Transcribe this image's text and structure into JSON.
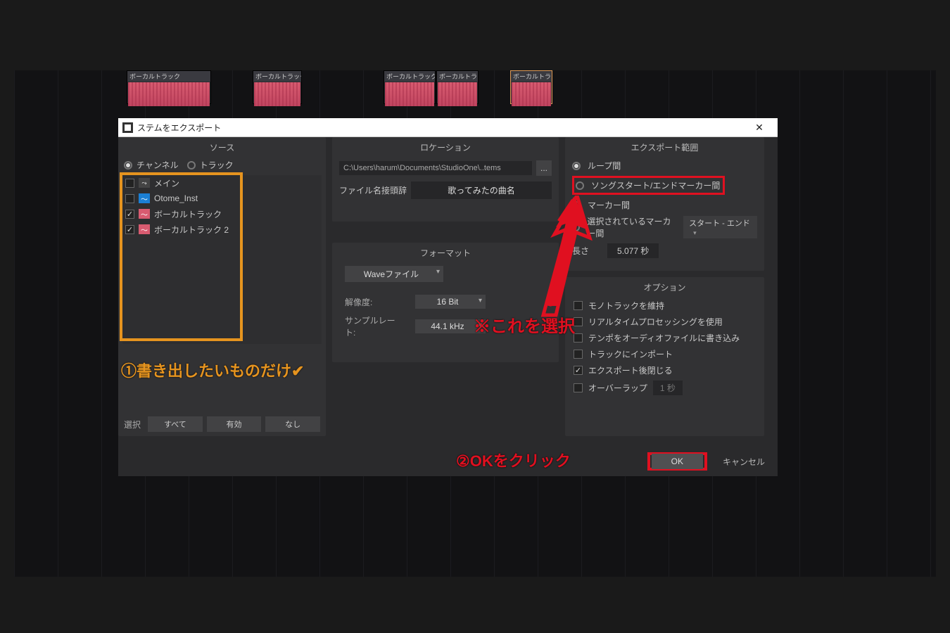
{
  "dialog": {
    "title": "ステムをエクスポート"
  },
  "source": {
    "header": "ソース",
    "radio_channel": "チャンネル",
    "radio_track": "トラック",
    "tracks": [
      {
        "checked": false,
        "icon": "out",
        "label": "メイン"
      },
      {
        "checked": false,
        "icon": "blue",
        "label": "Otome_Inst"
      },
      {
        "checked": true,
        "icon": "pink",
        "label": "ボーカルトラック"
      },
      {
        "checked": true,
        "icon": "pink",
        "label": "ボーカルトラック 2"
      }
    ],
    "select_label": "選択",
    "btn_all": "すべて",
    "btn_enabled": "有効",
    "btn_none": "なし"
  },
  "location": {
    "header": "ロケーション",
    "path": "C:\\Users\\harum\\Documents\\StudioOne\\..tems",
    "prefix_label": "ファイル名接頭辞",
    "prefix_value": "歌ってみたの曲名"
  },
  "format": {
    "header": "フォーマット",
    "filetype": "Waveファイル",
    "res_label": "解像度:",
    "res_value": "16 Bit",
    "rate_label": "サンプルレート:",
    "rate_value": "44.1 kHz"
  },
  "range": {
    "header": "エクスポート範囲",
    "opt_loop": "ループ間",
    "opt_songmarker": "ソングスタート/エンドマーカー間",
    "opt_marker": "マーカー間",
    "opt_selmarker": "選択されているマーカー間",
    "selmarker_value": "スタート - エンド",
    "length_label": "長さ",
    "length_value": "5.077 秒"
  },
  "options": {
    "header": "オプション",
    "opt_mono": "モノトラックを維持",
    "opt_realtime": "リアルタイムプロセッシングを使用",
    "opt_tempo": "テンポをオーディオファイルに書き込み",
    "opt_import": "トラックにインポート",
    "opt_close": "エクスポート後閉じる",
    "opt_overlap": "オーバーラップ",
    "overlap_value": "1 秒"
  },
  "buttons": {
    "ok": "OK",
    "cancel": "キャンセル"
  },
  "annotations": {
    "step1": "①書き出したいものだけ✔",
    "select_this": "※これを選択",
    "step2": "②OKをクリック"
  },
  "clips": {
    "label": "ボーカルトラック"
  }
}
